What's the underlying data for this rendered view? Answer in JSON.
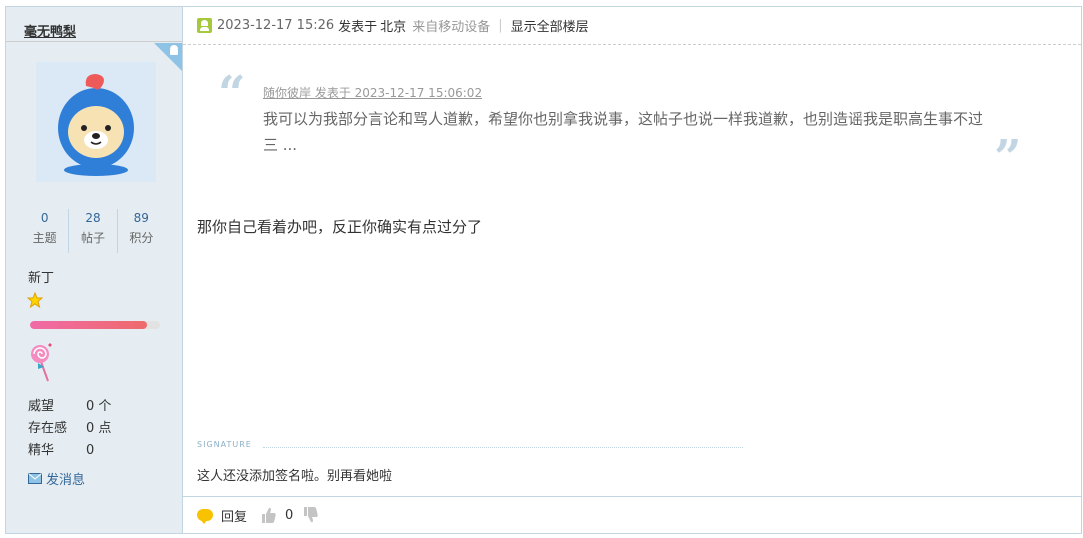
{
  "user": {
    "name": "毫无鸭梨",
    "stats": [
      {
        "value": "0",
        "label": "主题"
      },
      {
        "value": "28",
        "label": "帖子"
      },
      {
        "value": "89",
        "label": "积分"
      }
    ],
    "rank": "新丁",
    "progress": 0.9,
    "profile": [
      {
        "key": "威望",
        "value": "0 个"
      },
      {
        "key": "存在感",
        "value": "0 点"
      },
      {
        "key": "精华",
        "value": "0"
      }
    ],
    "send_message": "发消息"
  },
  "post": {
    "time": "2023-12-17 15:26",
    "posted_at_label": "发表于",
    "city": "北京",
    "device": "来自移动设备",
    "separator": "|",
    "show_all": "显示全部楼层",
    "quote": {
      "author_line": "随你彼岸 发表于 2023-12-17 15:06:02",
      "text": "我可以为我部分言论和骂人道歉，希望你也别拿我说事，这帖子也说一样我道歉，也别造谣我是职高生事不过三 ...",
      "open_mark": "“",
      "close_mark": "”"
    },
    "body": "那你自己看着办吧，反正你确实有点过分了",
    "signature_label": "SIGNATURE",
    "signature": "这人还没添加签名啦。别再看她啦",
    "reply_label": "回复",
    "like_count": "0"
  },
  "colors": {
    "border": "#c2d5e3",
    "sidebar_bg": "#e5edf2",
    "link": "#336699",
    "online": "#a5c93a"
  }
}
